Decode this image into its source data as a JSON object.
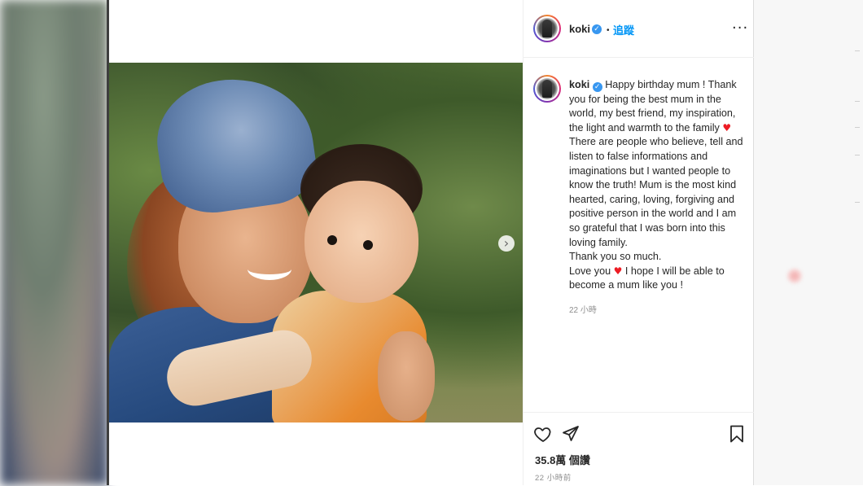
{
  "post": {
    "username": "koki",
    "verified_mark": "✓",
    "separator": "•",
    "follow_label": "追蹤",
    "more_label": "···",
    "next_label": "›",
    "caption_user": "koki",
    "caption_lines": [
      "Happy birthday mum ! Thank you for being the best mum in the world, my best friend, my inspiration, the light and warmth to the family ",
      "There are people who believe, tell and listen to false informations and imaginations but I wanted people to know the truth! Mum is the most kind hearted, caring, loving, forgiving and positive person in the world and I am so grateful that I was born into this loving family.\nThank you so much.\nLove you ",
      " I hope I will be able to become a mum like you !"
    ],
    "caption_heart": "♥",
    "caption_time": "22 小時",
    "likes": "35.8萬 個讚",
    "time_ago": "22 小時前",
    "icons": {
      "heart": "heart-icon",
      "share": "paper-plane-icon",
      "save": "bookmark-icon",
      "more": "more-dots-icon",
      "verified": "verified-badge-icon",
      "next": "chevron-right-icon"
    },
    "colors": {
      "link": "#0095f6",
      "verified": "#3897f0",
      "heart": "#ed1c24",
      "meta_text": "#8e8e8e"
    }
  }
}
